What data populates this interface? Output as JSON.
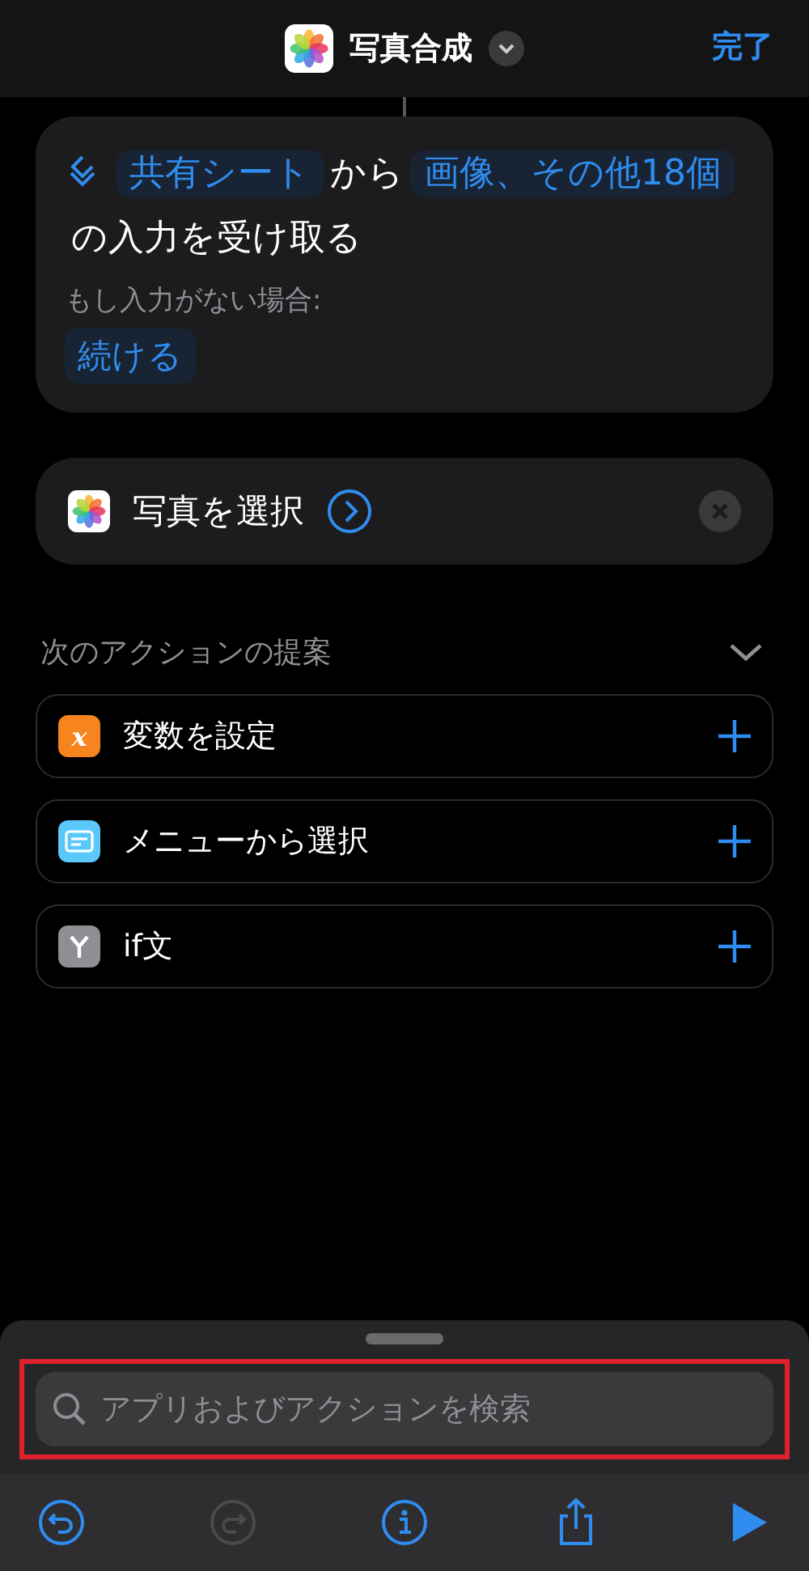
{
  "header": {
    "title": "写真合成",
    "done": "完了"
  },
  "receive_card": {
    "sentence": [
      {
        "kind": "token",
        "text": "共有シート"
      },
      {
        "kind": "plain",
        "text": "から"
      },
      {
        "kind": "token",
        "text": "画像、その他18個"
      },
      {
        "kind": "plain",
        "text": "の入力を受け取る"
      }
    ],
    "fallback_label": "もし入力がない場合:",
    "fallback_value": "続ける"
  },
  "action_card": {
    "title": "写真を選択"
  },
  "suggestions": {
    "title": "次のアクションの提案",
    "expanded": true,
    "items": [
      {
        "kind": "variable",
        "glyph": "x",
        "label": "変数を設定",
        "color": "#f7851f"
      },
      {
        "kind": "menu",
        "label": "メニューから選択",
        "color": "#5ac8fa"
      },
      {
        "kind": "branch",
        "label": "if文",
        "color": "#8e8e93"
      }
    ]
  },
  "search": {
    "placeholder": "アプリおよびアクションを検索",
    "highlighted": true
  },
  "toolbar": [
    {
      "kind": "undo",
      "disabled": false
    },
    {
      "kind": "redo",
      "disabled": true
    },
    {
      "kind": "info",
      "disabled": false
    },
    {
      "kind": "share",
      "disabled": false
    },
    {
      "kind": "run",
      "disabled": false
    }
  ]
}
